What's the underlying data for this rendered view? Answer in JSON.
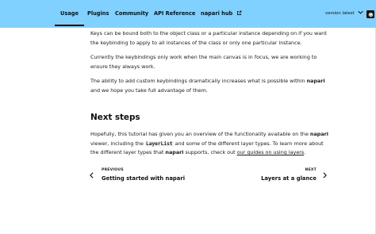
{
  "nav": {
    "items": [
      {
        "label": "Usage",
        "active": true
      },
      {
        "label": "Plugins"
      },
      {
        "label": "Community"
      },
      {
        "label": "API Reference"
      },
      {
        "label": "napari hub",
        "icon": "external-link-icon"
      }
    ],
    "version_label": "version latest",
    "version_icon": "chevron-down-icon",
    "github_icon": "github-icon"
  },
  "content": {
    "para1": "Keys can be bound both to the object class or a particular instance depending on if you want the keybinding to apply to all instances of the class or only one particular instance.",
    "para2": "Currently the keybindings only work when the main canvas is in focus, we are working to ensure they always work.",
    "para3_before": "The ability to add custom keybindings dramatically increases what is possible within ",
    "para3_bold": "napari",
    "para3_after": " and we hope you take full advantage of them.",
    "heading": "Next steps",
    "para4_a": "Hopefully, this tutorial has given you an overview of the functionality available on the ",
    "para4_b": "napari",
    "para4_c": " viewer, including the ",
    "para4_code": "LayerList",
    "para4_d": " and some of the different layer types. To learn more about the different layer types that ",
    "para4_e": "napari",
    "para4_f": " supports, check out ",
    "para4_link": "our guides on using layers",
    "para4_g": "."
  },
  "pager": {
    "prev_small": "PREVIOUS",
    "prev_title": "Getting started with napari",
    "next_small": "NEXT",
    "next_title": "Layers at a glance"
  },
  "colors": {
    "header_bg": "#80d1ff"
  }
}
